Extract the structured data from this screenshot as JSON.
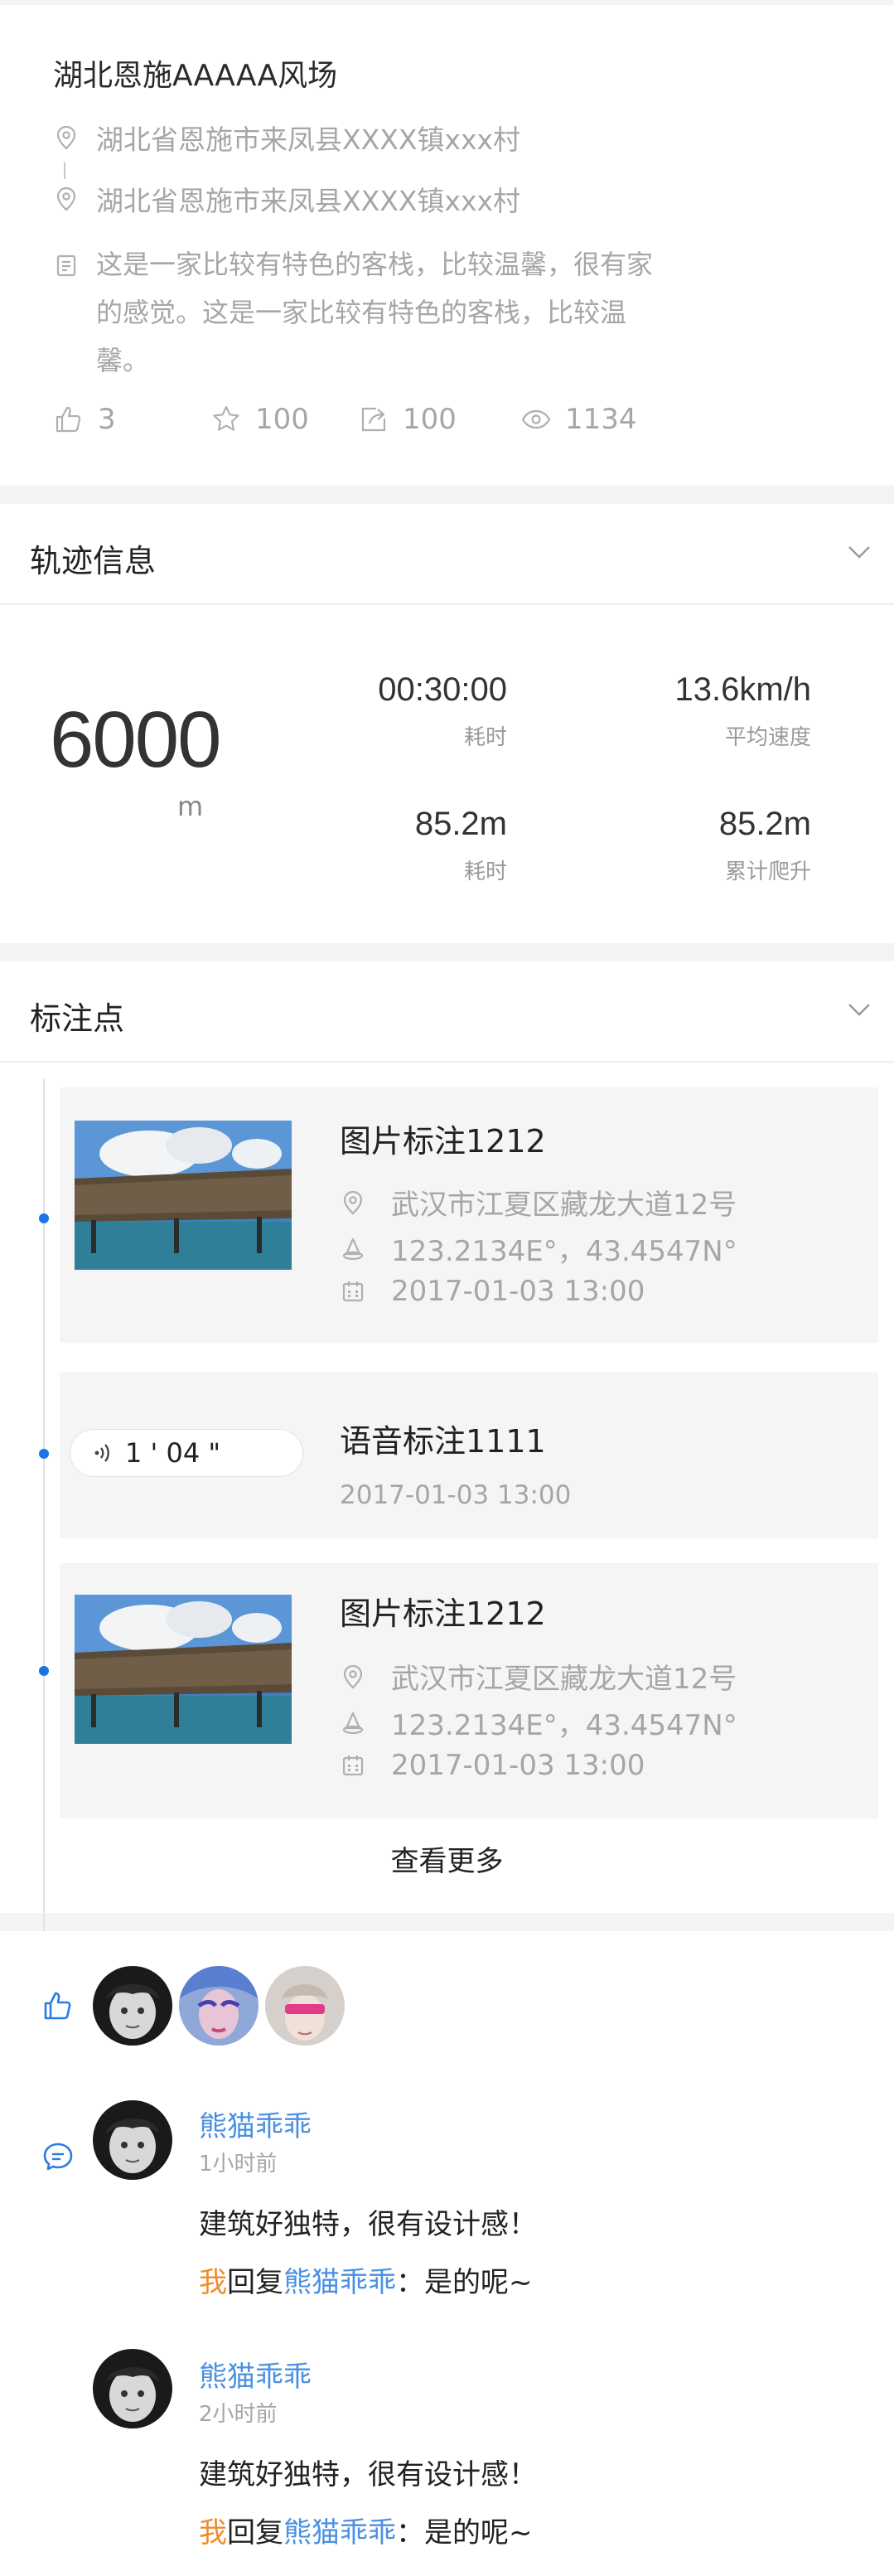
{
  "spot": {
    "title": "湖北恩施AAAAA风场",
    "location_from": "湖北省恩施市来凤县XXXX镇xxx村",
    "location_to": "湖北省恩施市来凤县XXXX镇xxx村",
    "description": "这是一家比较有特色的客栈，比较温馨，很有家的感觉。这是一家比较有特色的客栈，比较温馨。",
    "stats": [
      {
        "icon": "thumbs-up-icon",
        "value": "3"
      },
      {
        "icon": "star-icon",
        "value": "100"
      },
      {
        "icon": "share-icon",
        "value": "100"
      },
      {
        "icon": "eye-icon",
        "value": "1134"
      }
    ]
  },
  "track": {
    "title": "轨迹信息",
    "distance": "6000",
    "distance_unit": "m",
    "cells": [
      {
        "value": "00:30:00",
        "label": "耗时"
      },
      {
        "value": "13.6km/h",
        "label": "平均速度"
      },
      {
        "value": "85.2m",
        "label": "耗时"
      },
      {
        "value": "85.2m",
        "label": "累计爬升"
      }
    ]
  },
  "markers": {
    "title": "标注点",
    "items": [
      {
        "type": "image",
        "title": "图片标注1212",
        "address": "武汉市江夏区藏龙大道12号",
        "coords": "123.2134E°，43.4547N°",
        "time": "2017-01-03 13:00"
      },
      {
        "type": "voice",
        "title": "语音标注1111",
        "duration": "1 ' 04 \"",
        "time": "2017-01-03 13:00"
      },
      {
        "type": "image",
        "title": "图片标注1212",
        "address": "武汉市江夏区藏龙大道12号",
        "coords": "123.2134E°，43.4547N°",
        "time": "2017-01-03 13:00"
      }
    ],
    "more_label": "查看更多"
  },
  "social": {
    "comments": [
      {
        "name": "熊猫乖乖",
        "time": "1小时前",
        "text": "建筑好独特，很有设计感！",
        "reply_me": "我",
        "reply_word": "回复",
        "reply_to": "熊猫乖乖",
        "reply_text": "：是的呢~"
      },
      {
        "name": "熊猫乖乖",
        "time": "2小时前",
        "text": "建筑好独特，很有设计感！",
        "reply_me": "我",
        "reply_word": "回复",
        "reply_to": "熊猫乖乖",
        "reply_text": "：是的呢~"
      }
    ]
  },
  "colors": {
    "accent": "#1a73e8",
    "link": "#4a90e2",
    "me": "#f08c2e",
    "muted": "#a6a6a6"
  }
}
